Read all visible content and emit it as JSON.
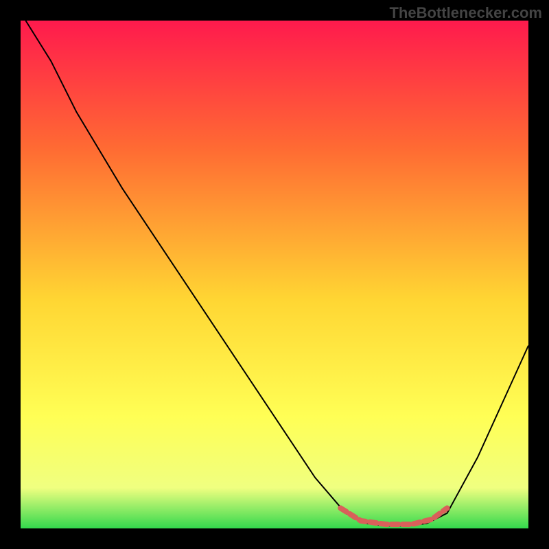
{
  "watermark": "TheBottlenecker.com",
  "chart_data": {
    "type": "line",
    "title": "",
    "xlabel": "",
    "ylabel": "",
    "xlim": [
      0,
      100
    ],
    "ylim": [
      0,
      100
    ],
    "background_gradient": {
      "stops": [
        {
          "offset": 0,
          "color": "#ff1a4d"
        },
        {
          "offset": 25,
          "color": "#ff6a33"
        },
        {
          "offset": 55,
          "color": "#ffd633"
        },
        {
          "offset": 78,
          "color": "#ffff55"
        },
        {
          "offset": 92,
          "color": "#f0ff80"
        },
        {
          "offset": 100,
          "color": "#33d94d"
        }
      ]
    },
    "series": [
      {
        "name": "curve",
        "color": "#000000",
        "width": 2,
        "points": [
          {
            "x": 1,
            "y": 100
          },
          {
            "x": 6,
            "y": 92
          },
          {
            "x": 11,
            "y": 82
          },
          {
            "x": 20,
            "y": 67
          },
          {
            "x": 30,
            "y": 52
          },
          {
            "x": 40,
            "y": 37
          },
          {
            "x": 50,
            "y": 22
          },
          {
            "x": 58,
            "y": 10
          },
          {
            "x": 64,
            "y": 3
          },
          {
            "x": 68,
            "y": 1
          },
          {
            "x": 72,
            "y": 0.5
          },
          {
            "x": 76,
            "y": 0.5
          },
          {
            "x": 80,
            "y": 1
          },
          {
            "x": 84,
            "y": 3
          },
          {
            "x": 90,
            "y": 14
          },
          {
            "x": 95,
            "y": 25
          },
          {
            "x": 100,
            "y": 36
          }
        ]
      },
      {
        "name": "highlight",
        "color": "#d9605a",
        "width": 8,
        "dash": "10,6",
        "points": [
          {
            "x": 63,
            "y": 4
          },
          {
            "x": 67,
            "y": 1.5
          },
          {
            "x": 72,
            "y": 0.8
          },
          {
            "x": 77,
            "y": 0.8
          },
          {
            "x": 81,
            "y": 1.8
          },
          {
            "x": 84,
            "y": 4
          }
        ]
      }
    ]
  }
}
